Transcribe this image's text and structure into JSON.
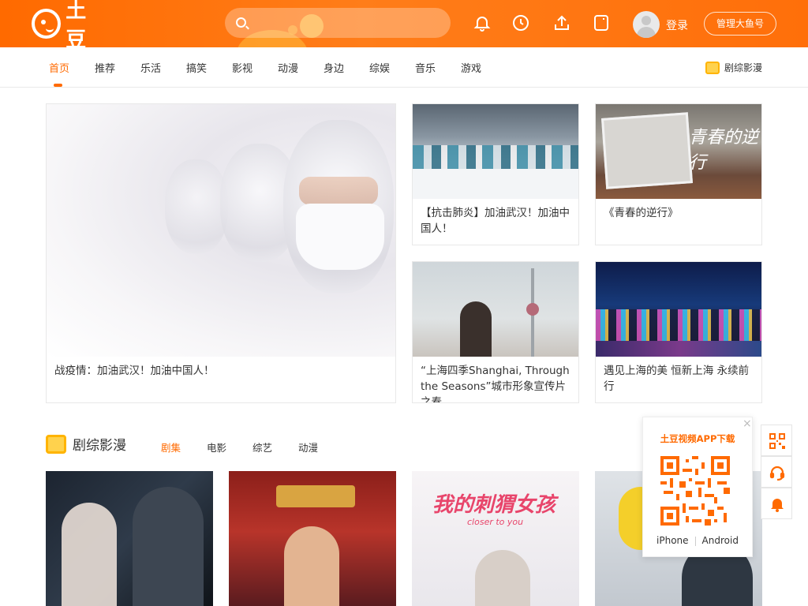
{
  "header": {
    "logo_text": "土豆",
    "search_placeholder": "",
    "login_label": "登录",
    "manage_label": "管理大鱼号",
    "brand_color": "#ff6a00"
  },
  "nav": {
    "items": [
      {
        "label": "首页",
        "active": true
      },
      {
        "label": "推荐"
      },
      {
        "label": "乐活"
      },
      {
        "label": "搞笑"
      },
      {
        "label": "影视"
      },
      {
        "label": "动漫"
      },
      {
        "label": "身边"
      },
      {
        "label": "综娱"
      },
      {
        "label": "音乐"
      },
      {
        "label": "游戏"
      }
    ],
    "right_label": "剧综影漫"
  },
  "featured": {
    "hero_caption": "战疫情：加油武汉！加油中国人！",
    "cards": [
      {
        "caption": "【抗击肺炎】加油武汉！加油中国人！"
      },
      {
        "caption": "《青春的逆行》"
      },
      {
        "caption": "“上海四季Shanghai, Through the Seasons”城市形象宣传片之春"
      },
      {
        "caption": "遇见上海的美 恒新上海 永续前行"
      }
    ]
  },
  "section": {
    "title": "剧综影漫",
    "tabs": [
      {
        "label": "剧集",
        "active": true
      },
      {
        "label": "电影"
      },
      {
        "label": "综艺"
      },
      {
        "label": "动漫"
      }
    ],
    "poster3_title": "我的刺猬女孩",
    "poster3_sub": "closer to you"
  },
  "popup": {
    "title": "土豆视频APP下载",
    "close": "×",
    "iphone_label": "iPhone",
    "android_label": "Android"
  },
  "side": {
    "icons": [
      "qr-code-icon",
      "headset-icon",
      "bell-icon"
    ]
  }
}
